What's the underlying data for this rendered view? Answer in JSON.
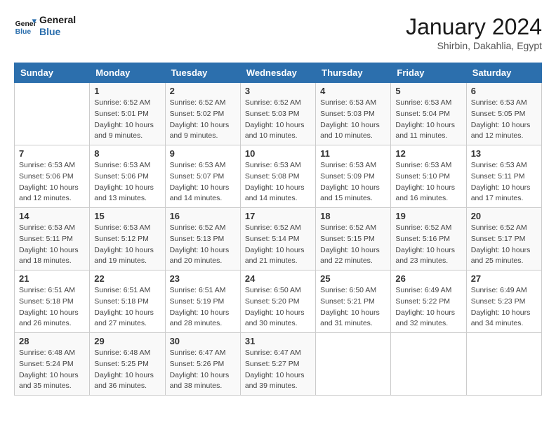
{
  "header": {
    "logo_line1": "General",
    "logo_line2": "Blue",
    "month": "January 2024",
    "location": "Shirbin, Dakahlia, Egypt"
  },
  "days_of_week": [
    "Sunday",
    "Monday",
    "Tuesday",
    "Wednesday",
    "Thursday",
    "Friday",
    "Saturday"
  ],
  "weeks": [
    [
      {
        "day": "",
        "info": ""
      },
      {
        "day": "1",
        "info": "Sunrise: 6:52 AM\nSunset: 5:01 PM\nDaylight: 10 hours\nand 9 minutes."
      },
      {
        "day": "2",
        "info": "Sunrise: 6:52 AM\nSunset: 5:02 PM\nDaylight: 10 hours\nand 9 minutes."
      },
      {
        "day": "3",
        "info": "Sunrise: 6:52 AM\nSunset: 5:03 PM\nDaylight: 10 hours\nand 10 minutes."
      },
      {
        "day": "4",
        "info": "Sunrise: 6:53 AM\nSunset: 5:03 PM\nDaylight: 10 hours\nand 10 minutes."
      },
      {
        "day": "5",
        "info": "Sunrise: 6:53 AM\nSunset: 5:04 PM\nDaylight: 10 hours\nand 11 minutes."
      },
      {
        "day": "6",
        "info": "Sunrise: 6:53 AM\nSunset: 5:05 PM\nDaylight: 10 hours\nand 12 minutes."
      }
    ],
    [
      {
        "day": "7",
        "info": "Sunrise: 6:53 AM\nSunset: 5:06 PM\nDaylight: 10 hours\nand 12 minutes."
      },
      {
        "day": "8",
        "info": "Sunrise: 6:53 AM\nSunset: 5:06 PM\nDaylight: 10 hours\nand 13 minutes."
      },
      {
        "day": "9",
        "info": "Sunrise: 6:53 AM\nSunset: 5:07 PM\nDaylight: 10 hours\nand 14 minutes."
      },
      {
        "day": "10",
        "info": "Sunrise: 6:53 AM\nSunset: 5:08 PM\nDaylight: 10 hours\nand 14 minutes."
      },
      {
        "day": "11",
        "info": "Sunrise: 6:53 AM\nSunset: 5:09 PM\nDaylight: 10 hours\nand 15 minutes."
      },
      {
        "day": "12",
        "info": "Sunrise: 6:53 AM\nSunset: 5:10 PM\nDaylight: 10 hours\nand 16 minutes."
      },
      {
        "day": "13",
        "info": "Sunrise: 6:53 AM\nSunset: 5:11 PM\nDaylight: 10 hours\nand 17 minutes."
      }
    ],
    [
      {
        "day": "14",
        "info": "Sunrise: 6:53 AM\nSunset: 5:11 PM\nDaylight: 10 hours\nand 18 minutes."
      },
      {
        "day": "15",
        "info": "Sunrise: 6:53 AM\nSunset: 5:12 PM\nDaylight: 10 hours\nand 19 minutes."
      },
      {
        "day": "16",
        "info": "Sunrise: 6:52 AM\nSunset: 5:13 PM\nDaylight: 10 hours\nand 20 minutes."
      },
      {
        "day": "17",
        "info": "Sunrise: 6:52 AM\nSunset: 5:14 PM\nDaylight: 10 hours\nand 21 minutes."
      },
      {
        "day": "18",
        "info": "Sunrise: 6:52 AM\nSunset: 5:15 PM\nDaylight: 10 hours\nand 22 minutes."
      },
      {
        "day": "19",
        "info": "Sunrise: 6:52 AM\nSunset: 5:16 PM\nDaylight: 10 hours\nand 23 minutes."
      },
      {
        "day": "20",
        "info": "Sunrise: 6:52 AM\nSunset: 5:17 PM\nDaylight: 10 hours\nand 25 minutes."
      }
    ],
    [
      {
        "day": "21",
        "info": "Sunrise: 6:51 AM\nSunset: 5:18 PM\nDaylight: 10 hours\nand 26 minutes."
      },
      {
        "day": "22",
        "info": "Sunrise: 6:51 AM\nSunset: 5:18 PM\nDaylight: 10 hours\nand 27 minutes."
      },
      {
        "day": "23",
        "info": "Sunrise: 6:51 AM\nSunset: 5:19 PM\nDaylight: 10 hours\nand 28 minutes."
      },
      {
        "day": "24",
        "info": "Sunrise: 6:50 AM\nSunset: 5:20 PM\nDaylight: 10 hours\nand 30 minutes."
      },
      {
        "day": "25",
        "info": "Sunrise: 6:50 AM\nSunset: 5:21 PM\nDaylight: 10 hours\nand 31 minutes."
      },
      {
        "day": "26",
        "info": "Sunrise: 6:49 AM\nSunset: 5:22 PM\nDaylight: 10 hours\nand 32 minutes."
      },
      {
        "day": "27",
        "info": "Sunrise: 6:49 AM\nSunset: 5:23 PM\nDaylight: 10 hours\nand 34 minutes."
      }
    ],
    [
      {
        "day": "28",
        "info": "Sunrise: 6:48 AM\nSunset: 5:24 PM\nDaylight: 10 hours\nand 35 minutes."
      },
      {
        "day": "29",
        "info": "Sunrise: 6:48 AM\nSunset: 5:25 PM\nDaylight: 10 hours\nand 36 minutes."
      },
      {
        "day": "30",
        "info": "Sunrise: 6:47 AM\nSunset: 5:26 PM\nDaylight: 10 hours\nand 38 minutes."
      },
      {
        "day": "31",
        "info": "Sunrise: 6:47 AM\nSunset: 5:27 PM\nDaylight: 10 hours\nand 39 minutes."
      },
      {
        "day": "",
        "info": ""
      },
      {
        "day": "",
        "info": ""
      },
      {
        "day": "",
        "info": ""
      }
    ]
  ]
}
